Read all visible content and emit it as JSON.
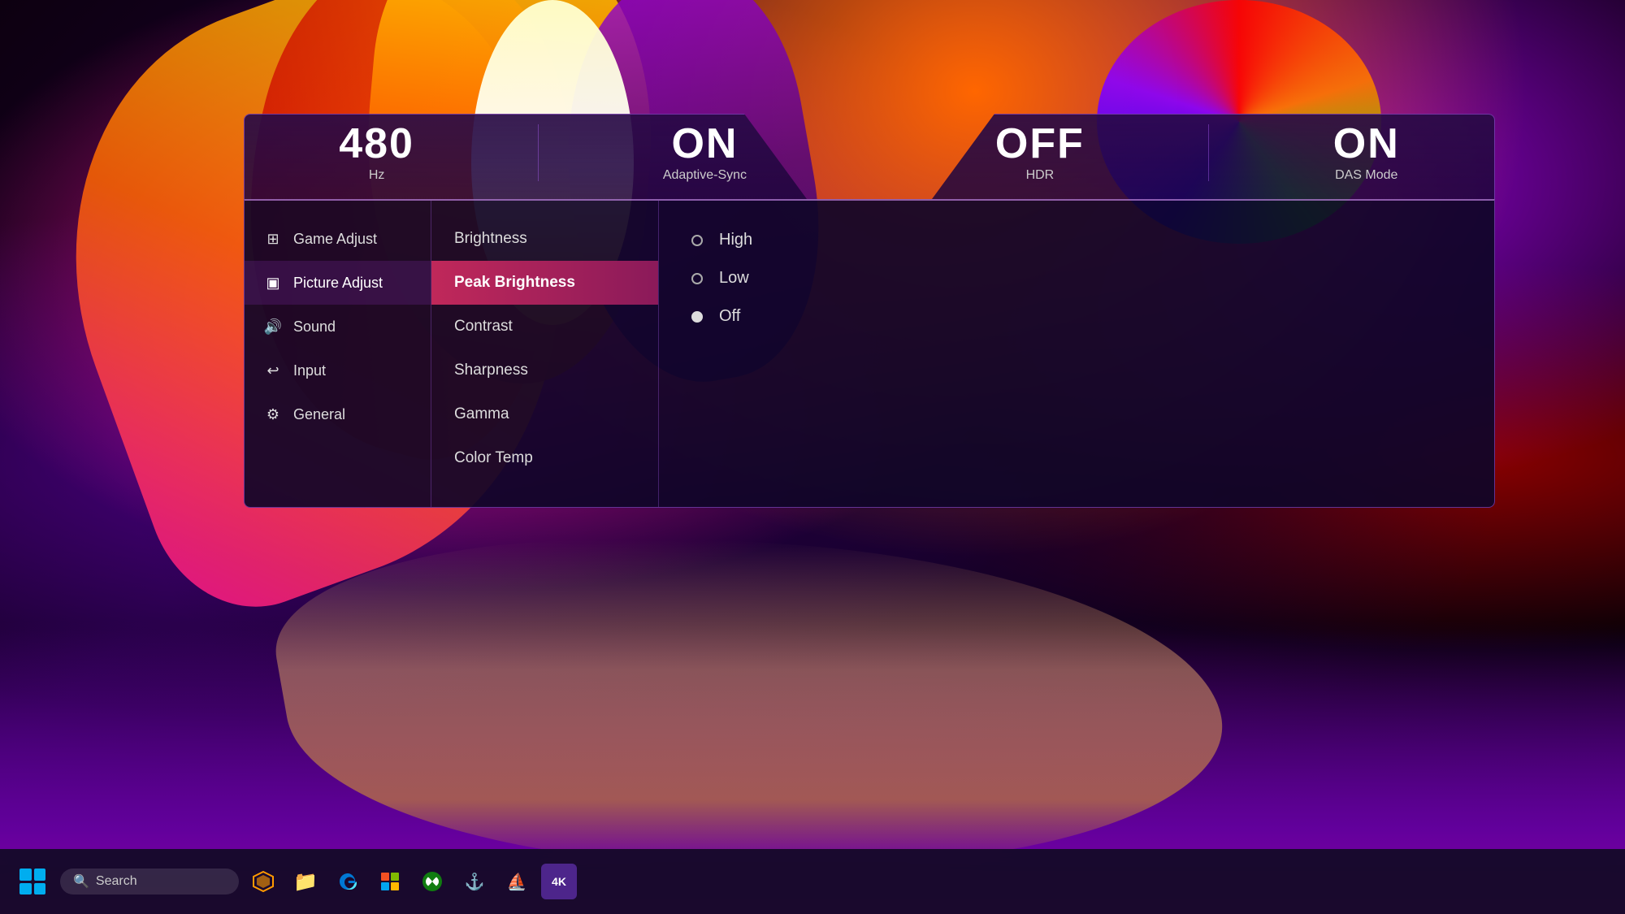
{
  "background": {
    "description": "Abstract colorful desktop wallpaper with pink, orange, yellow, purple shapes"
  },
  "osd": {
    "status_bar": {
      "items": [
        {
          "value": "480",
          "unit": "Hz",
          "id": "hz"
        },
        {
          "value": "ON",
          "label": "Adaptive-Sync",
          "id": "adaptive-sync"
        },
        {
          "value": "OFF",
          "label": "HDR",
          "id": "hdr"
        },
        {
          "value": "ON",
          "label": "DAS Mode",
          "id": "das-mode"
        }
      ]
    },
    "sidebar": {
      "items": [
        {
          "id": "game-adjust",
          "label": "Game Adjust",
          "icon": "⊞",
          "active": false
        },
        {
          "id": "picture-adjust",
          "label": "Picture Adjust",
          "icon": "🖥",
          "active": true
        },
        {
          "id": "sound",
          "label": "Sound",
          "icon": "🔊",
          "active": false
        },
        {
          "id": "input",
          "label": "Input",
          "icon": "↩",
          "active": false
        },
        {
          "id": "general",
          "label": "General",
          "icon": "⚙",
          "active": false
        }
      ]
    },
    "center_menu": {
      "items": [
        {
          "id": "brightness",
          "label": "Brightness",
          "active": false
        },
        {
          "id": "peak-brightness",
          "label": "Peak Brightness",
          "active": true
        },
        {
          "id": "contrast",
          "label": "Contrast",
          "active": false
        },
        {
          "id": "sharpness",
          "label": "Sharpness",
          "active": false
        },
        {
          "id": "gamma",
          "label": "Gamma",
          "active": false
        },
        {
          "id": "color-temp",
          "label": "Color Temp",
          "active": false
        }
      ]
    },
    "right_panel": {
      "title": "Peak Brightness",
      "options": [
        {
          "id": "high",
          "label": "High",
          "selected": false
        },
        {
          "id": "low",
          "label": "Low",
          "selected": false
        },
        {
          "id": "off",
          "label": "Off",
          "selected": true
        }
      ]
    }
  },
  "taskbar": {
    "search_placeholder": "Search",
    "icons": [
      {
        "id": "cortana",
        "symbol": "📊",
        "label": "Cortana"
      },
      {
        "id": "file-explorer",
        "symbol": "📁",
        "label": "File Explorer"
      },
      {
        "id": "edge",
        "symbol": "🌐",
        "label": "Microsoft Edge"
      },
      {
        "id": "store",
        "symbol": "🛍",
        "label": "Microsoft Store"
      },
      {
        "id": "xbox",
        "symbol": "🎮",
        "label": "Xbox"
      },
      {
        "id": "corsair1",
        "symbol": "⛵",
        "label": "Corsair iCUE"
      },
      {
        "id": "corsair2",
        "symbol": "⛵",
        "label": "Corsair"
      },
      {
        "id": "resolution",
        "symbol": "4K",
        "label": "4K Resolution"
      }
    ]
  }
}
